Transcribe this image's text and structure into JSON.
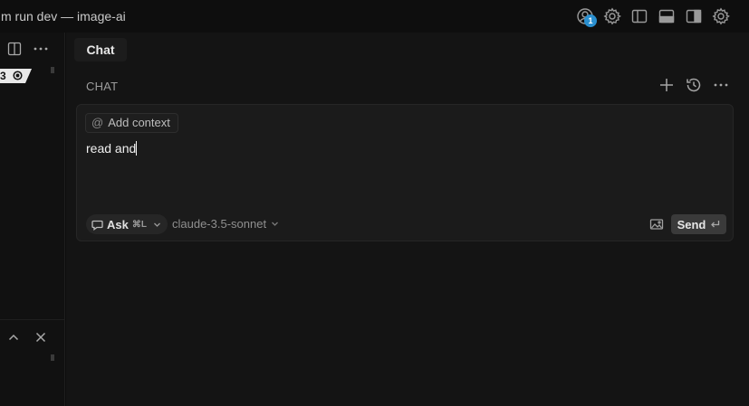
{
  "window": {
    "title": "m run dev — image-ai"
  },
  "titlebar": {
    "icons": [
      "account-icon",
      "settings-icon",
      "toggle-primary-sidebar-icon",
      "toggle-panel-icon",
      "toggle-secondary-sidebar-icon",
      "settings-gear-icon"
    ],
    "account_badge": "1",
    "badge_color": "#2a8fcf"
  },
  "left_panel": {
    "tab_badge": {
      "count": "3"
    }
  },
  "chat": {
    "tab_label": "Chat",
    "header_label": "CHAT",
    "composer": {
      "add_context_label": "Add context",
      "input_value": "read and",
      "mode": {
        "label": "Ask",
        "shortcut": "⌘L"
      },
      "model": "claude-3.5-sonnet",
      "send_label": "Send"
    }
  }
}
